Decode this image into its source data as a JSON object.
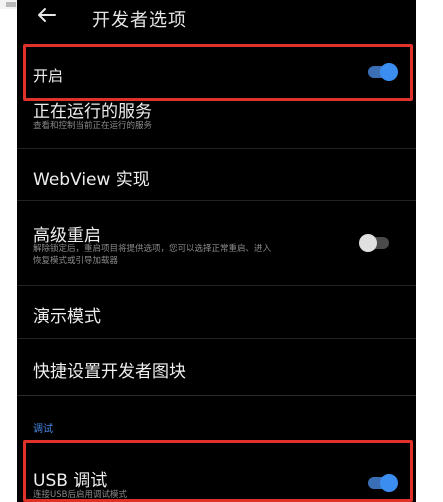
{
  "header": {
    "title": "开发者选项",
    "back_icon": "arrow-left-icon"
  },
  "items": {
    "enable": {
      "title": "开启",
      "toggle": "on"
    },
    "running_services": {
      "title": "正在运行的服务",
      "subtitle": "查看和控制当前正在运行的服务"
    },
    "webview": {
      "title": "WebView 实现"
    },
    "advanced_reboot": {
      "title": "高级重启",
      "subtitle_line1": "解除锁定后，重启项目将提供选项，您可以选择正常重启、进入",
      "subtitle_line2": "恢复模式或引导加载器",
      "toggle": "off"
    },
    "demo_mode": {
      "title": "演示模式"
    },
    "quick_settings": {
      "title": "快捷设置开发者图块"
    },
    "usb_debug": {
      "title": "USB 调试",
      "subtitle": "连接USB后启用调试模式",
      "toggle": "on"
    }
  },
  "sections": {
    "debug": "调试"
  },
  "colors": {
    "accent": "#3b8ef0",
    "highlight": "#e0322a",
    "background": "#000000"
  }
}
